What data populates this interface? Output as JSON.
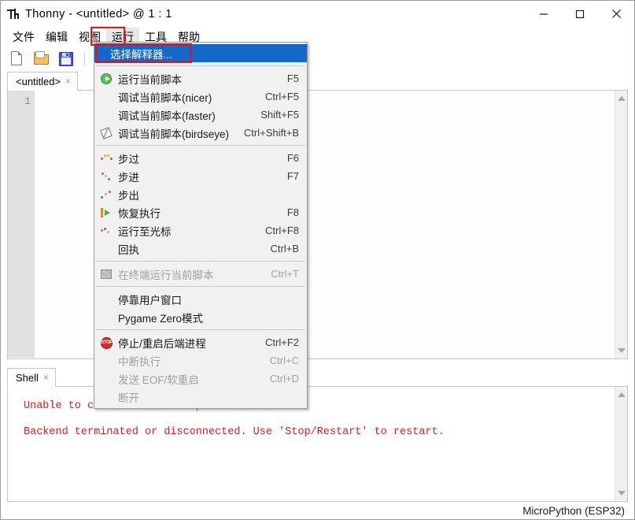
{
  "window": {
    "title": "Thonny  -  <untitled>  @  1 : 1",
    "icon": "thonny-logo-icon",
    "minimize": "—",
    "maximize": "□",
    "close": "✕"
  },
  "menubar": {
    "items": [
      {
        "label": "文件",
        "name": "menu-file"
      },
      {
        "label": "编辑",
        "name": "menu-edit"
      },
      {
        "label": "视图",
        "name": "menu-view"
      },
      {
        "label": "运行",
        "name": "menu-run",
        "active": true
      },
      {
        "label": "工具",
        "name": "menu-tools"
      },
      {
        "label": "帮助",
        "name": "menu-help"
      }
    ]
  },
  "toolbar": {
    "buttons": [
      {
        "name": "new-file-icon",
        "icon": "new-file-icon"
      },
      {
        "name": "open-file-icon",
        "icon": "open-folder-icon"
      },
      {
        "name": "save-file-icon",
        "icon": "save-disk-icon"
      },
      {
        "name": "run-script-icon",
        "icon": "run-play-icon",
        "disabled": true
      }
    ]
  },
  "editor": {
    "tab_label": "<untitled>",
    "tab_close": "×",
    "line_number": "1",
    "content": ""
  },
  "run_menu": {
    "items": [
      {
        "label": "选择解释器...",
        "accel": "",
        "icon": "",
        "selected": true,
        "disabled": false
      },
      {
        "separator": true
      },
      {
        "label": "运行当前脚本",
        "accel": "F5",
        "icon": "run-play-icon",
        "disabled": false
      },
      {
        "label": "调试当前脚本(nicer)",
        "accel": "Ctrl+F5",
        "icon": "",
        "disabled": false
      },
      {
        "label": "调试当前脚本(faster)",
        "accel": "Shift+F5",
        "icon": "",
        "disabled": false
      },
      {
        "label": "调试当前脚本(birdseye)",
        "accel": "Ctrl+Shift+B",
        "icon": "birdseye-icon",
        "disabled": false
      },
      {
        "separator": true
      },
      {
        "label": "步过",
        "accel": "F6",
        "icon": "step-over-icon",
        "disabled": false
      },
      {
        "label": "步进",
        "accel": "F7",
        "icon": "step-into-icon",
        "disabled": false
      },
      {
        "label": "步出",
        "accel": "",
        "icon": "step-out-icon",
        "disabled": false
      },
      {
        "label": "恢复执行",
        "accel": "F8",
        "icon": "resume-icon",
        "disabled": false
      },
      {
        "label": "运行至光标",
        "accel": "Ctrl+F8",
        "icon": "run-to-cursor-icon",
        "disabled": false
      },
      {
        "label": "回执",
        "accel": "Ctrl+B",
        "icon": "",
        "disabled": false
      },
      {
        "separator": true
      },
      {
        "label": "在终端运行当前脚本",
        "accel": "Ctrl+T",
        "icon": "terminal-icon",
        "disabled": true
      },
      {
        "separator": true
      },
      {
        "label": "停靠用户窗口",
        "accel": "",
        "icon": "",
        "disabled": false
      },
      {
        "label": "Pygame Zero模式",
        "accel": "",
        "icon": "",
        "disabled": false
      },
      {
        "separator": true
      },
      {
        "label": "停止/重启后端进程",
        "accel": "Ctrl+F2",
        "icon": "stop-icon",
        "disabled": false
      },
      {
        "label": "中断执行",
        "accel": "Ctrl+C",
        "icon": "",
        "disabled": true
      },
      {
        "label": "发送 EOF/软重启",
        "accel": "Ctrl+D",
        "icon": "",
        "disabled": true
      },
      {
        "label": "断开",
        "accel": "",
        "icon": "",
        "disabled": true
      }
    ]
  },
  "shell": {
    "tab_label": "Shell",
    "tab_close": "×",
    "lines": [
      "Unable to connect to COM5: port not found",
      "",
      "Backend terminated or disconnected. Use 'Stop/Restart' to restart."
    ],
    "text_color": "#c62828"
  },
  "statusbar": {
    "interpreter": "MicroPython (ESP32)"
  },
  "annotations": {
    "accent_color": "#e8121c",
    "run_menu_box": "运行",
    "selected_item_box": "选择解释器..."
  }
}
